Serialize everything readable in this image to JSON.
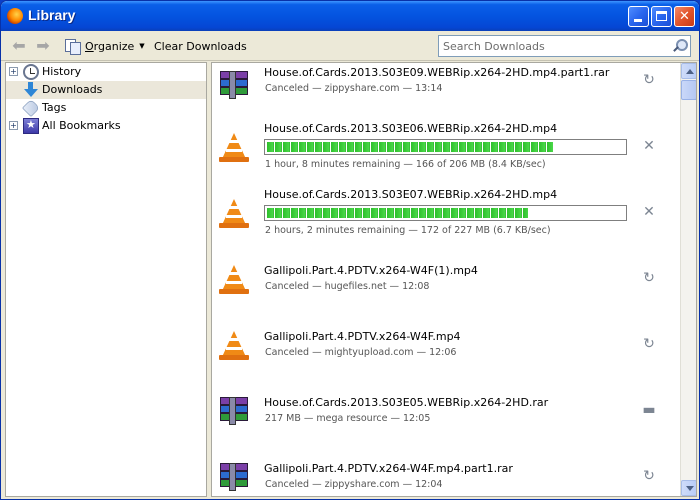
{
  "window": {
    "title": "Library"
  },
  "toolbar": {
    "organize_label": "Organize",
    "clear_downloads_label": "Clear Downloads",
    "search_placeholder": "Search Downloads"
  },
  "sidebar": {
    "items": [
      {
        "label": "History",
        "icon": "clock-icon",
        "expandable": true
      },
      {
        "label": "Downloads",
        "icon": "download-arrow-icon",
        "expandable": false,
        "selected": true
      },
      {
        "label": "Tags",
        "icon": "tag-icon",
        "expandable": false
      },
      {
        "label": "All Bookmarks",
        "icon": "bookmarks-star-icon",
        "expandable": true
      }
    ]
  },
  "downloads": [
    {
      "name": "House.of.Cards.2013.S03E09.WEBRip.x264-2HD.mp4.part1.rar",
      "status": "Canceled — zippyshare.com — 13:14",
      "icon": "rar-archive-icon",
      "action": "retry-icon",
      "state": "canceled"
    },
    {
      "name": "House.of.Cards.2013.S03E06.WEBRip.x264-2HD.mp4",
      "status": "1 hour, 8 minutes remaining — 166 of 206 MB (8.4 KB/sec)",
      "icon": "vlc-cone-icon",
      "action": "cancel-icon",
      "state": "downloading",
      "progress": 0.8
    },
    {
      "name": "House.of.Cards.2013.S03E07.WEBRip.x264-2HD.mp4",
      "status": "2 hours, 2 minutes remaining — 172 of 227 MB (6.7 KB/sec)",
      "icon": "vlc-cone-icon",
      "action": "cancel-icon",
      "state": "downloading",
      "progress": 0.73
    },
    {
      "name": "Gallipoli.Part.4.PDTV.x264-W4F(1).mp4",
      "status": "Canceled — hugefiles.net — 12:08",
      "icon": "vlc-cone-icon",
      "action": "retry-icon",
      "state": "canceled"
    },
    {
      "name": "Gallipoli.Part.4.PDTV.x264-W4F.mp4",
      "status": "Canceled — mightyupload.com — 12:06",
      "icon": "vlc-cone-icon",
      "action": "retry-icon",
      "state": "canceled"
    },
    {
      "name": "House.of.Cards.2013.S03E05.WEBRip.x264-2HD.rar",
      "status": "217 MB — mega resource — 12:05",
      "icon": "rar-archive-icon",
      "action": "folder-icon",
      "state": "done"
    },
    {
      "name": "Gallipoli.Part.4.PDTV.x264-W4F.mp4.part1.rar",
      "status": "Canceled — zippyshare.com — 12:04",
      "icon": "rar-archive-icon",
      "action": "retry-icon",
      "state": "canceled"
    }
  ],
  "colors": {
    "titlebar": "#0454e0",
    "progress_green": "#2dbf2b",
    "vlc_orange": "#f08a16",
    "selection": "#ebe7da"
  }
}
